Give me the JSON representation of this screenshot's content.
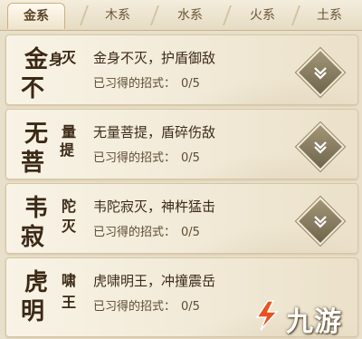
{
  "tabs": [
    {
      "label": "金系",
      "active": true
    },
    {
      "label": "木系",
      "active": false
    },
    {
      "label": "水系",
      "active": false
    },
    {
      "label": "火系",
      "active": false
    },
    {
      "label": "土系",
      "active": false
    }
  ],
  "skills": [
    {
      "emblem": [
        "金",
        "身",
        "不",
        "灭"
      ],
      "name": "金身不灭，护盾御敌",
      "progress_label": "已习得的招式：",
      "progress": "0/5"
    },
    {
      "emblem": [
        "无",
        "量",
        "菩",
        "提"
      ],
      "name": "无量菩提，盾碎伤敌",
      "progress_label": "已习得的招式：",
      "progress": "0/5"
    },
    {
      "emblem": [
        "韦",
        "陀",
        "寂",
        "灭"
      ],
      "name": "韦陀寂灭，神杵猛击",
      "progress_label": "已习得的招式：",
      "progress": "0/5"
    },
    {
      "emblem": [
        "虎",
        "啸",
        "明",
        "王"
      ],
      "name": "虎啸明王，冲撞震岳",
      "progress_label": "已习得的招式：",
      "progress": "0/5"
    }
  ],
  "watermark": {
    "text": "九游",
    "icon": "jiuyou-logo-icon",
    "color": "#e8531d"
  },
  "colors": {
    "accent": "#5a4326",
    "button": "#8a7d60"
  }
}
